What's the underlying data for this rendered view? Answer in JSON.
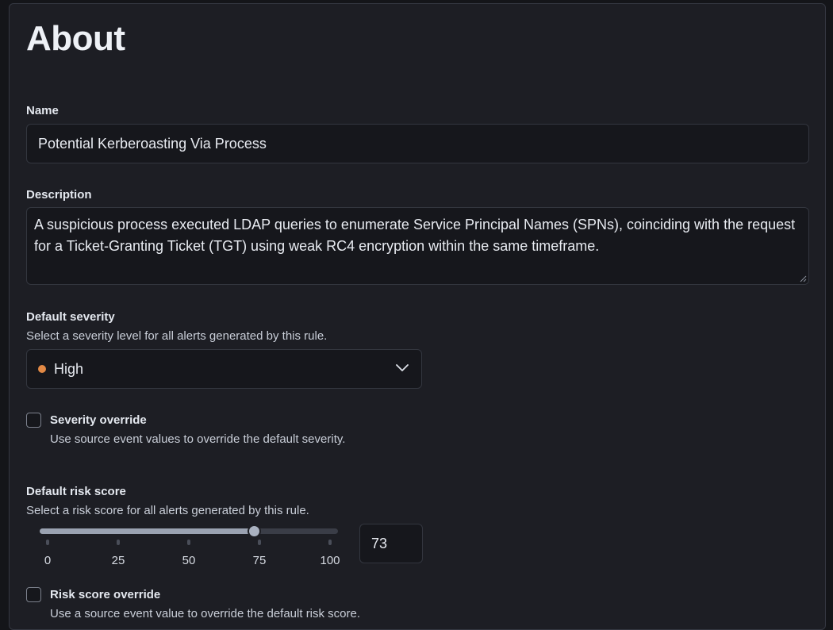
{
  "about": {
    "title": "About"
  },
  "name_field": {
    "label": "Name",
    "value": "Potential Kerberoasting Via Process"
  },
  "description_field": {
    "label": "Description",
    "value": "A suspicious process executed LDAP queries to enumerate Service Principal Names (SPNs), coinciding with the request for a Ticket-Granting Ticket (TGT) using weak RC4 encryption within the same timeframe."
  },
  "severity": {
    "label": "Default severity",
    "help": "Select a severity level for all alerts generated by this rule.",
    "selected": "High",
    "selected_color": "#e28945"
  },
  "severity_override": {
    "label": "Severity override",
    "help": "Use source event values to override the default severity.",
    "checked": false
  },
  "risk_score": {
    "label": "Default risk score",
    "help": "Select a risk score for all alerts generated by this rule.",
    "value": "73",
    "min": 0,
    "max": 100,
    "ticks": [
      "0",
      "25",
      "50",
      "75",
      "100"
    ]
  },
  "risk_score_override": {
    "label": "Risk score override",
    "help": "Use a source event value to override the default risk score.",
    "checked": false
  },
  "icons": {
    "chevron": "chevron-down-icon",
    "resize": "resize-grip-icon",
    "severity_dot": "status-dot-icon"
  }
}
